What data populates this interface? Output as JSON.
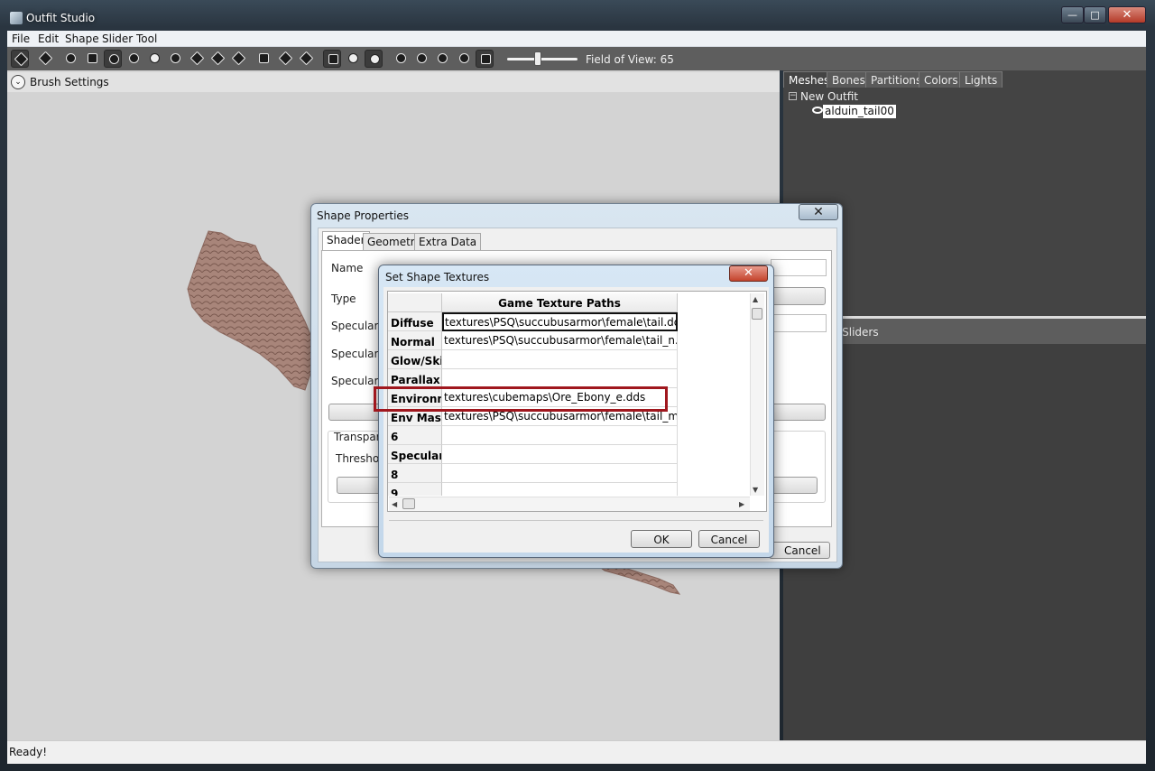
{
  "window": {
    "title": "Outfit Studio",
    "minimize": "—",
    "maximize": "□",
    "close": "✕"
  },
  "menu": [
    "File",
    "Edit",
    "Shape",
    "Slider",
    "Tool"
  ],
  "toolbar": {
    "fov_label": "Field of View: 65",
    "fov_value": 65
  },
  "brush_settings": {
    "chevron": "⌄",
    "label": "Brush Settings"
  },
  "side_tabs": [
    "Meshes",
    "Bones",
    "Partitions",
    "Colors",
    "Lights"
  ],
  "tree": {
    "toggle": "−",
    "root": "New Outfit",
    "child": "alduin_tail00"
  },
  "slider_panel": {
    "label": "ct Sliders"
  },
  "status": "Ready!",
  "shape_properties": {
    "title": "Shape Properties",
    "close": "✕",
    "tabs": [
      "Shader",
      "Geometry",
      "Extra Data"
    ],
    "labels": {
      "name": "Name",
      "type": "Type",
      "spec_color": "Specular C",
      "spec_strength": "Specular S",
      "spec_power": "Specular P",
      "transparency": "Transpare",
      "threshold": "Threshold"
    },
    "cancel": "Cancel"
  },
  "set_shape_textures": {
    "title": "Set Shape Textures",
    "close": "✕",
    "column_header": "Game Texture Paths",
    "rows": [
      {
        "label": "Diffuse",
        "value": "textures\\PSQ\\succubusarmor\\female\\tail.dds"
      },
      {
        "label": "Normal",
        "value": "textures\\PSQ\\succubusarmor\\female\\tail_n.dds"
      },
      {
        "label": "Glow/Skin",
        "value": ""
      },
      {
        "label": "Parallax",
        "value": ""
      },
      {
        "label": "Environme",
        "value": "textures\\cubemaps\\Ore_Ebony_e.dds"
      },
      {
        "label": "Env Mask",
        "value": "textures\\PSQ\\succubusarmor\\female\\tail_m.dds"
      },
      {
        "label": "6",
        "value": ""
      },
      {
        "label": "Specular",
        "value": ""
      },
      {
        "label": "8",
        "value": ""
      },
      {
        "label": "9",
        "value": ""
      }
    ],
    "ok": "OK",
    "cancel": "Cancel",
    "scroll_up": "▲",
    "scroll_down": "▼",
    "scroll_left": "◀",
    "scroll_right": "▶"
  }
}
